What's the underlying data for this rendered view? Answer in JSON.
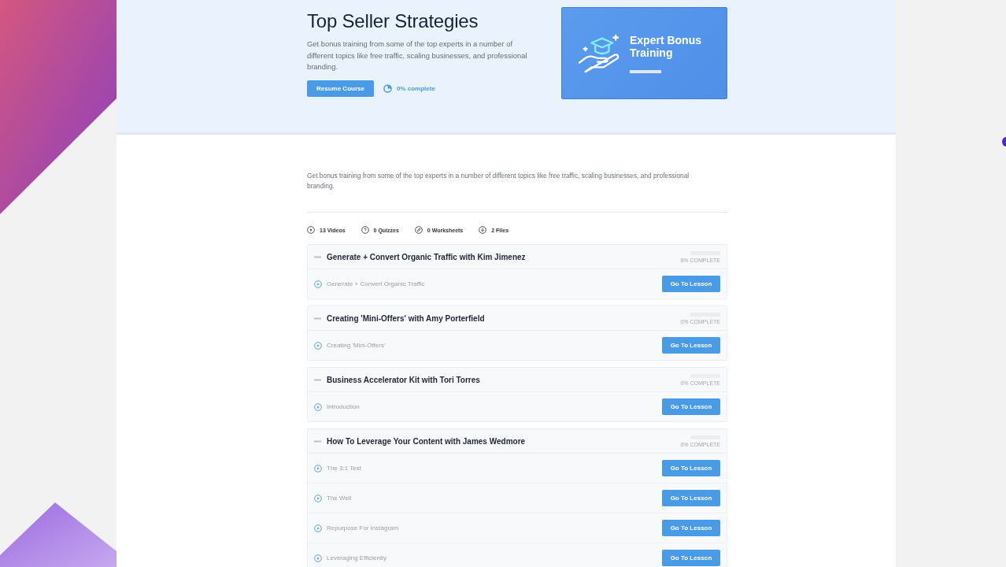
{
  "hero": {
    "title": "Top Seller Strategies",
    "description": "Get bonus training from some of the top experts in a number of different topics like free traffic, scaling businesses, and professional branding.",
    "resume_button": "Resume Course",
    "progress_label": "0% complete",
    "thumbnail_title": "Expert Bonus Training"
  },
  "description": "Get bonus training from some of the top experts in a number of different topics like free traffic, scaling businesses, and professional branding.",
  "stats": [
    {
      "kind": "video",
      "label": "13 Videos"
    },
    {
      "kind": "quiz",
      "label": "0 Quizzes"
    },
    {
      "kind": "worksheet",
      "label": "0 Worksheets"
    },
    {
      "kind": "file",
      "label": "2 Files"
    }
  ],
  "sections": [
    {
      "title": "Generate + Convert Organic Traffic with Kim Jimenez",
      "expanded": true,
      "level": 0,
      "progress_label": "0% COMPLETE",
      "lessons": [
        {
          "title": "Generate + Convert Organic Traffic",
          "button": "Go To Lesson"
        }
      ]
    },
    {
      "title": "Creating 'Mini-Offers' with Amy Porterfield",
      "expanded": true,
      "level": 0,
      "progress_label": "0% COMPLETE",
      "lessons": [
        {
          "title": "Creating 'Mini-Offers'",
          "button": "Go To Lesson"
        }
      ]
    },
    {
      "title": "Business Accelerator Kit with Tori Torres",
      "expanded": true,
      "level": 0,
      "progress_label": "0% COMPLETE",
      "lessons": [
        {
          "title": "Introduction",
          "button": "Go To Lesson"
        }
      ]
    },
    {
      "title": "How To Leverage Your Content with James Wedmore",
      "expanded": true,
      "level": 0,
      "progress_label": "0% COMPLETE",
      "lessons": [
        {
          "title": "The 3:1 Test",
          "button": "Go To Lesson"
        },
        {
          "title": "The Well",
          "button": "Go To Lesson"
        },
        {
          "title": "Repurpose For Instagram",
          "button": "Go To Lesson"
        },
        {
          "title": "Leveraging Efficiently",
          "button": "Go To Lesson"
        }
      ]
    }
  ]
}
